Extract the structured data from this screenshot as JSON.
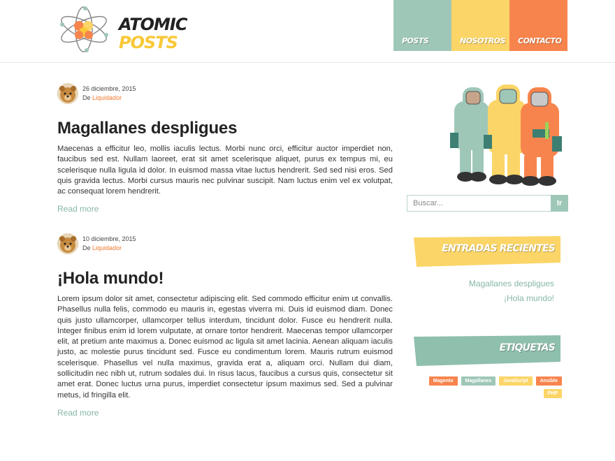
{
  "site": {
    "logo_line1": "ATOMIC",
    "logo_line2": "POSTS"
  },
  "nav": [
    {
      "label": "POSTS",
      "color": "#9fc7b8"
    },
    {
      "label": "NOSOTROS",
      "color": "#fbd567"
    },
    {
      "label": "CONTACTO",
      "color": "#f7844d"
    }
  ],
  "posts": [
    {
      "date": "26 diciembre, 2015",
      "author_prefix": "De",
      "author": "Liquidador",
      "title": "Magallanes despligues",
      "body": "Maecenas a efficitur leo, mollis iaculis lectus. Morbi nunc orci, efficitur auctor imperdiet non, faucibus sed est. Nullam laoreet, erat sit amet scelerisque aliquet, purus ex tempus mi, eu scelerisque nulla ligula id dolor. In euismod massa vitae luctus hendrerit. Sed sed nisi eros. Sed quis gravida lectus. Morbi cursus mauris nec pulvinar suscipit. Nam luctus enim vel ex volutpat, ac consequat lorem hendrerit.",
      "read_more": "Read more"
    },
    {
      "date": "10 diciembre, 2015",
      "author_prefix": "De",
      "author": "Liquidador",
      "title": "¡Hola mundo!",
      "body": "Lorem ipsum dolor sit amet, consectetur adipiscing elit. Sed commodo efficitur enim ut convallis. Phasellus nulla felis, commodo eu mauris in, egestas viverra mi. Duis id euismod diam. Donec quis justo ullamcorper, ullamcorper tellus interdum, tincidunt dolor. Fusce eu hendrerit nulla. Integer finibus enim id lorem vulputate, at ornare tortor hendrerit. Maecenas tempor ullamcorper elit, at pretium ante maximus a. Donec euismod ac ligula sit amet lacinia. Aenean aliquam iaculis justo, ac molestie purus tincidunt sed. Fusce eu condimentum lorem. Mauris rutrum euismod scelerisque. Phasellus vel nulla maximus, gravida erat a, aliquam orci. Nullam dui diam, sollicitudin nec nibh ut, rutrum sodales dui. In risus lacus, faucibus a cursus quis, consectetur sit amet erat. Donec luctus urna purus, imperdiet consectetur ipsum maximus sed. Sed a pulvinar metus, id fringilla elit.",
      "read_more": "Read more"
    }
  ],
  "search": {
    "placeholder": "Buscar...",
    "button": "Ir"
  },
  "recent": {
    "title": "ENTRADAS RECIENTES",
    "items": [
      "Magallanes despligues",
      "¡Hola mundo!"
    ]
  },
  "tags": {
    "title": "ETIQUETAS",
    "items": [
      {
        "label": "Magento",
        "color": "#f7844d"
      },
      {
        "label": "Magallanes",
        "color": "#9fc7b8"
      },
      {
        "label": "JavaScript",
        "color": "#fbd567"
      },
      {
        "label": "Ansible",
        "color": "#f7844d"
      },
      {
        "label": "PHP",
        "color": "#fbd567"
      }
    ]
  },
  "colors": {
    "green": "#9fc7b8",
    "yellow": "#fbd567",
    "orange": "#f7844d",
    "link": "#86b7a5"
  }
}
